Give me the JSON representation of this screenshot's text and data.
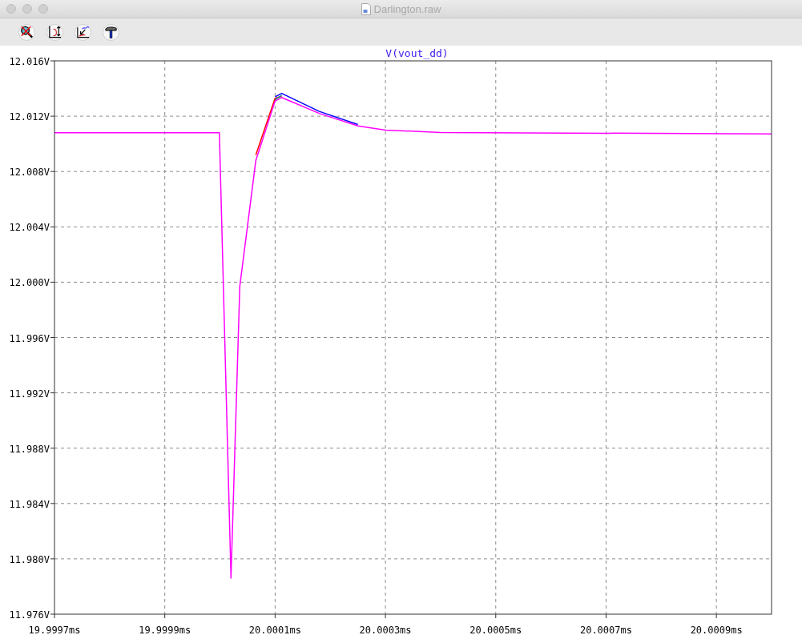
{
  "window": {
    "title": "Darlington.raw"
  },
  "toolbar": {
    "buttons": [
      {
        "kind": "magnifier"
      },
      {
        "kind": "axes"
      },
      {
        "kind": "curve"
      },
      {
        "kind": "hammer"
      }
    ]
  },
  "plot": {
    "chart_data": {
      "type": "line",
      "title": "V(vout_dd)",
      "x": [
        19.9997,
        19.999999,
        20.00002,
        20.000036,
        20.000065,
        20.0001,
        20.000112,
        20.00018,
        20.00025,
        20.0003,
        20.0004,
        20.001
      ],
      "series": [
        {
          "color": "#0000ff",
          "values": [
            null,
            null,
            null,
            null,
            null,
            12.0134,
            12.01365,
            12.01235,
            12.0114,
            null,
            null,
            null
          ]
        },
        {
          "color": "#ff0000",
          "values": [
            null,
            null,
            null,
            null,
            12.0092,
            12.0133,
            12.01345,
            null,
            null,
            null,
            null,
            null
          ]
        },
        {
          "color": "#008c8c",
          "values": [
            null,
            null,
            null,
            null,
            null,
            12.0132,
            12.0135,
            null,
            null,
            null,
            null,
            null
          ]
        },
        {
          "color": "#ff00ff",
          "values": [
            12.0108,
            12.0108,
            11.9786,
            11.9997,
            12.0088,
            12.0131,
            12.01335,
            12.0122,
            12.0113,
            12.011,
            12.01082,
            12.01072
          ]
        }
      ],
      "grid": true,
      "xlim": [
        19.9997,
        20.001
      ],
      "ylim": [
        11.976,
        12.016
      ],
      "xticks": [
        {
          "value": 19.9997,
          "label": "19.9997ms"
        },
        {
          "value": 19.9999,
          "label": "19.9999ms"
        },
        {
          "value": 20.0001,
          "label": "20.0001ms"
        },
        {
          "value": 20.0003,
          "label": "20.0003ms"
        },
        {
          "value": 20.0005,
          "label": "20.0005ms"
        },
        {
          "value": 20.0007,
          "label": "20.0007ms"
        },
        {
          "value": 20.0009,
          "label": "20.0009ms"
        }
      ],
      "yticks": [
        {
          "value": 12.016,
          "label": "12.016V"
        },
        {
          "value": 12.012,
          "label": "12.012V"
        },
        {
          "value": 12.008,
          "label": "12.008V"
        },
        {
          "value": 12.004,
          "label": "12.004V"
        },
        {
          "value": 12.0,
          "label": "12.000V"
        },
        {
          "value": 11.996,
          "label": "11.996V"
        },
        {
          "value": 11.992,
          "label": "11.992V"
        },
        {
          "value": 11.988,
          "label": "11.988V"
        },
        {
          "value": 11.984,
          "label": "11.984V"
        },
        {
          "value": 11.98,
          "label": "11.980V"
        },
        {
          "value": 11.976,
          "label": "11.976V"
        }
      ]
    }
  }
}
